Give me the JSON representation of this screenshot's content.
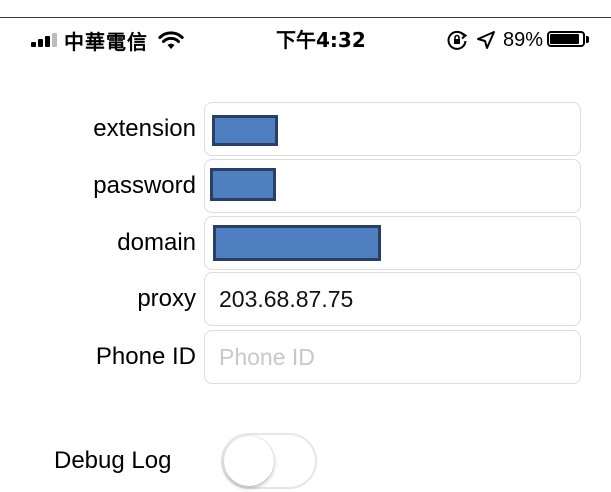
{
  "status_bar": {
    "carrier": "中華電信",
    "time": "下午4:32",
    "battery_percent": "89%",
    "battery_level": 0.89,
    "icons": [
      "signal-icon",
      "wifi-icon",
      "rotation-lock-icon",
      "location-arrow-icon",
      "battery-icon"
    ]
  },
  "form": {
    "extension": {
      "label": "extension",
      "value": "",
      "redacted": true
    },
    "password": {
      "label": "password",
      "value": "",
      "redacted": true
    },
    "domain": {
      "label": "domain",
      "value": "",
      "redacted": true
    },
    "proxy": {
      "label": "proxy",
      "value": "203.68.87.75"
    },
    "phone_id": {
      "label": "Phone ID",
      "value": "",
      "placeholder": "Phone ID"
    }
  },
  "debug_log": {
    "label": "Debug Log",
    "enabled": false
  },
  "colors": {
    "redaction_fill": "#4d7fc1",
    "redaction_border": "#2a3f66",
    "field_border": "#dcdcdc",
    "placeholder": "#c7c7cd"
  }
}
